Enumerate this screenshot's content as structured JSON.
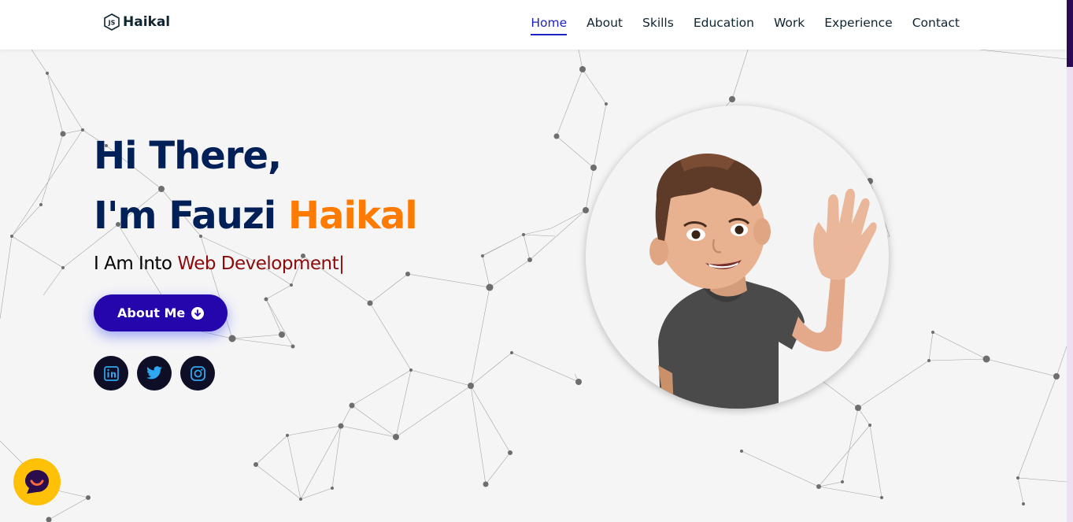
{
  "brand": {
    "name": "Haikal",
    "logo_icon": "nodejs-hexagon-icon"
  },
  "nav": {
    "items": [
      {
        "label": "Home",
        "active": true
      },
      {
        "label": "About",
        "active": false
      },
      {
        "label": "Skills",
        "active": false
      },
      {
        "label": "Education",
        "active": false
      },
      {
        "label": "Work",
        "active": false
      },
      {
        "label": "Experience",
        "active": false
      },
      {
        "label": "Contact",
        "active": false
      }
    ]
  },
  "hero": {
    "greeting": "Hi There,",
    "intro_prefix": "I'm Fauzi ",
    "intro_name": "Haikal",
    "tagline_prefix": "I Am Into ",
    "tagline_typed": "Web Development|",
    "button_label": "About Me",
    "button_icon": "arrow-circle-down-icon"
  },
  "socials": [
    {
      "name": "linkedin",
      "icon": "linkedin-icon"
    },
    {
      "name": "twitter",
      "icon": "twitter-icon"
    },
    {
      "name": "instagram",
      "icon": "instagram-icon"
    }
  ],
  "avatar": {
    "icon": "memoji-waving-avatar"
  },
  "chat": {
    "icon": "chat-widget-icon"
  },
  "colors": {
    "navy": "#002057",
    "orange": "#ff7a00",
    "maroon": "#8b0b0b",
    "button": "#2506ad",
    "nav_active": "#1d22c4",
    "chat": "#ffc107"
  }
}
